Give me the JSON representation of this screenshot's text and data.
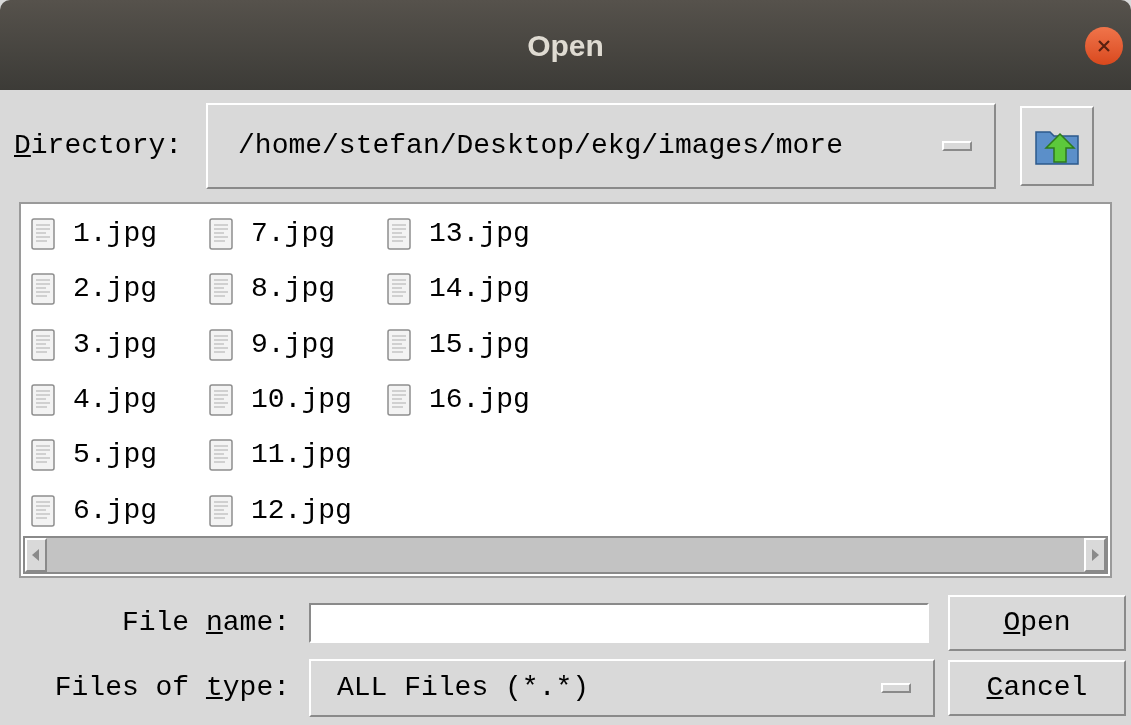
{
  "window": {
    "title": "Open"
  },
  "directory": {
    "label": {
      "key": "D",
      "after": "irectory:"
    },
    "value": "/home/stefan/Desktop/ekg/images/more"
  },
  "files": [
    {
      "name": "1.jpg"
    },
    {
      "name": "2.jpg"
    },
    {
      "name": "3.jpg"
    },
    {
      "name": "4.jpg"
    },
    {
      "name": "5.jpg"
    },
    {
      "name": "6.jpg"
    },
    {
      "name": "7.jpg"
    },
    {
      "name": "8.jpg"
    },
    {
      "name": "9.jpg"
    },
    {
      "name": "10.jpg"
    },
    {
      "name": "11.jpg"
    },
    {
      "name": "12.jpg"
    },
    {
      "name": "13.jpg"
    },
    {
      "name": "14.jpg"
    },
    {
      "name": "15.jpg"
    },
    {
      "name": "16.jpg"
    }
  ],
  "file_name": {
    "label": {
      "before": "File ",
      "key": "n",
      "after": "ame:"
    }
  },
  "file_type": {
    "label": {
      "before": "Files of ",
      "key": "t",
      "after": "ype:"
    },
    "value": "ALL Files (*.*)"
  },
  "buttons": [
    {
      "key": "O",
      "after": "pen"
    },
    {
      "key": "C",
      "after": "ancel"
    }
  ]
}
